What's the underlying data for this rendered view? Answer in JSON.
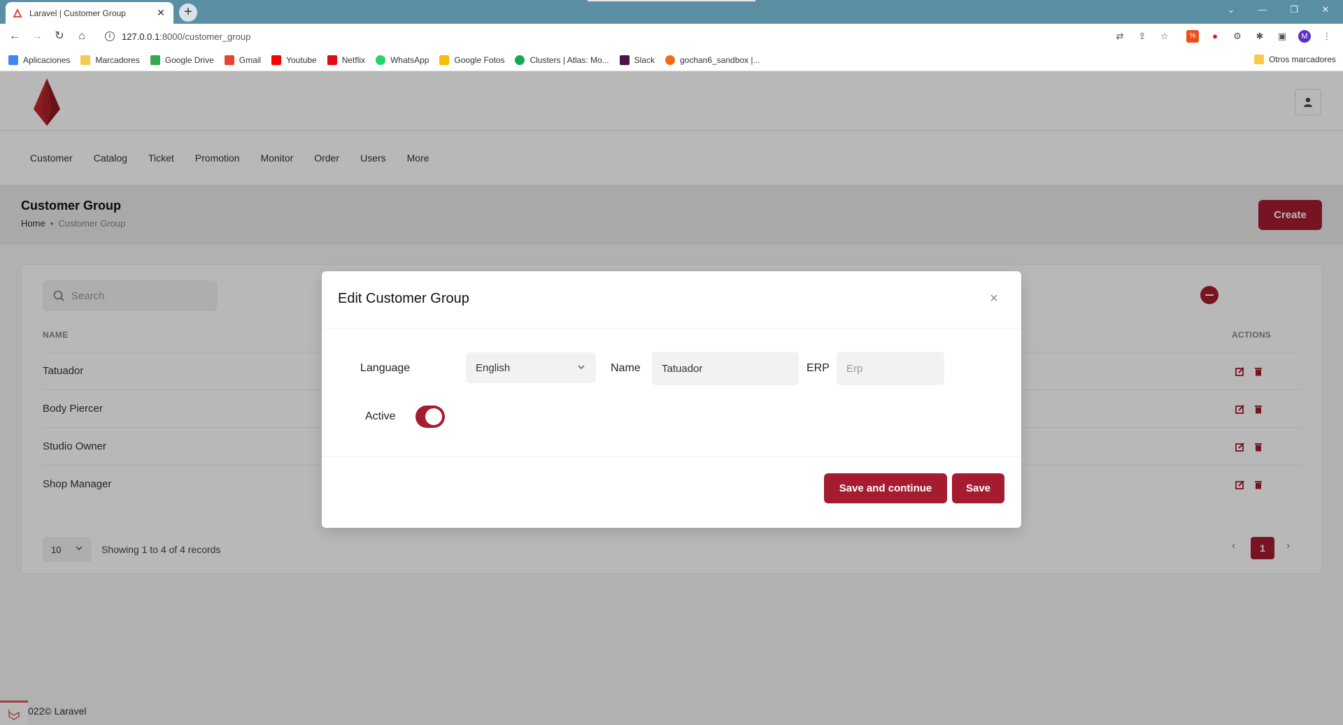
{
  "browser": {
    "tab_title": "Laravel | Customer Group",
    "url_host": "127.0.0.1",
    "url_rest": ":8000/customer_group",
    "profile_initial": "M",
    "bookmarks": [
      {
        "label": "Aplicaciones",
        "color": "#4285f4"
      },
      {
        "label": "Marcadores",
        "color": "#f6c94a"
      },
      {
        "label": "Google Drive",
        "color": "#34a853"
      },
      {
        "label": "Gmail",
        "color": "#ea4335"
      },
      {
        "label": "Youtube",
        "color": "#ff0000"
      },
      {
        "label": "Netflix",
        "color": "#e50914"
      },
      {
        "label": "WhatsApp",
        "color": "#25d366"
      },
      {
        "label": "Google Fotos",
        "color": "#fbbc05"
      },
      {
        "label": "Clusters | Atlas: Mo...",
        "color": "#13aa52"
      },
      {
        "label": "Slack",
        "color": "#4a154b"
      },
      {
        "label": "gochan6_sandbox |...",
        "color": "#f26b1d"
      }
    ],
    "other_bookmarks": "Otros marcadores"
  },
  "nav": {
    "menu": [
      "Customer",
      "Catalog",
      "Ticket",
      "Promotion",
      "Monitor",
      "Order",
      "Users",
      "More"
    ]
  },
  "header": {
    "title": "Customer Group",
    "breadcrumb_home": "Home",
    "breadcrumb_current": "Customer Group",
    "create_label": "Create"
  },
  "table": {
    "search_placeholder": "Search",
    "col_name": "NAME",
    "col_actions": "ACTIONS",
    "rows": [
      "Tatuador",
      "Body Piercer",
      "Studio Owner",
      "Shop Manager"
    ],
    "page_size": "10",
    "records_text": "Showing 1 to 4 of 4 records",
    "current_page": "1"
  },
  "footer": {
    "text": "022© Laravel"
  },
  "modal": {
    "title": "Edit Customer Group",
    "language_label": "Language",
    "language_value": "English",
    "name_label": "Name",
    "name_value": "Tatuador",
    "erp_label": "ERP",
    "erp_placeholder": "Erp",
    "active_label": "Active",
    "active": true,
    "save_continue_label": "Save and continue",
    "save_label": "Save"
  },
  "colors": {
    "accent": "#a51c30",
    "tabbar": "#5a8fa3"
  }
}
